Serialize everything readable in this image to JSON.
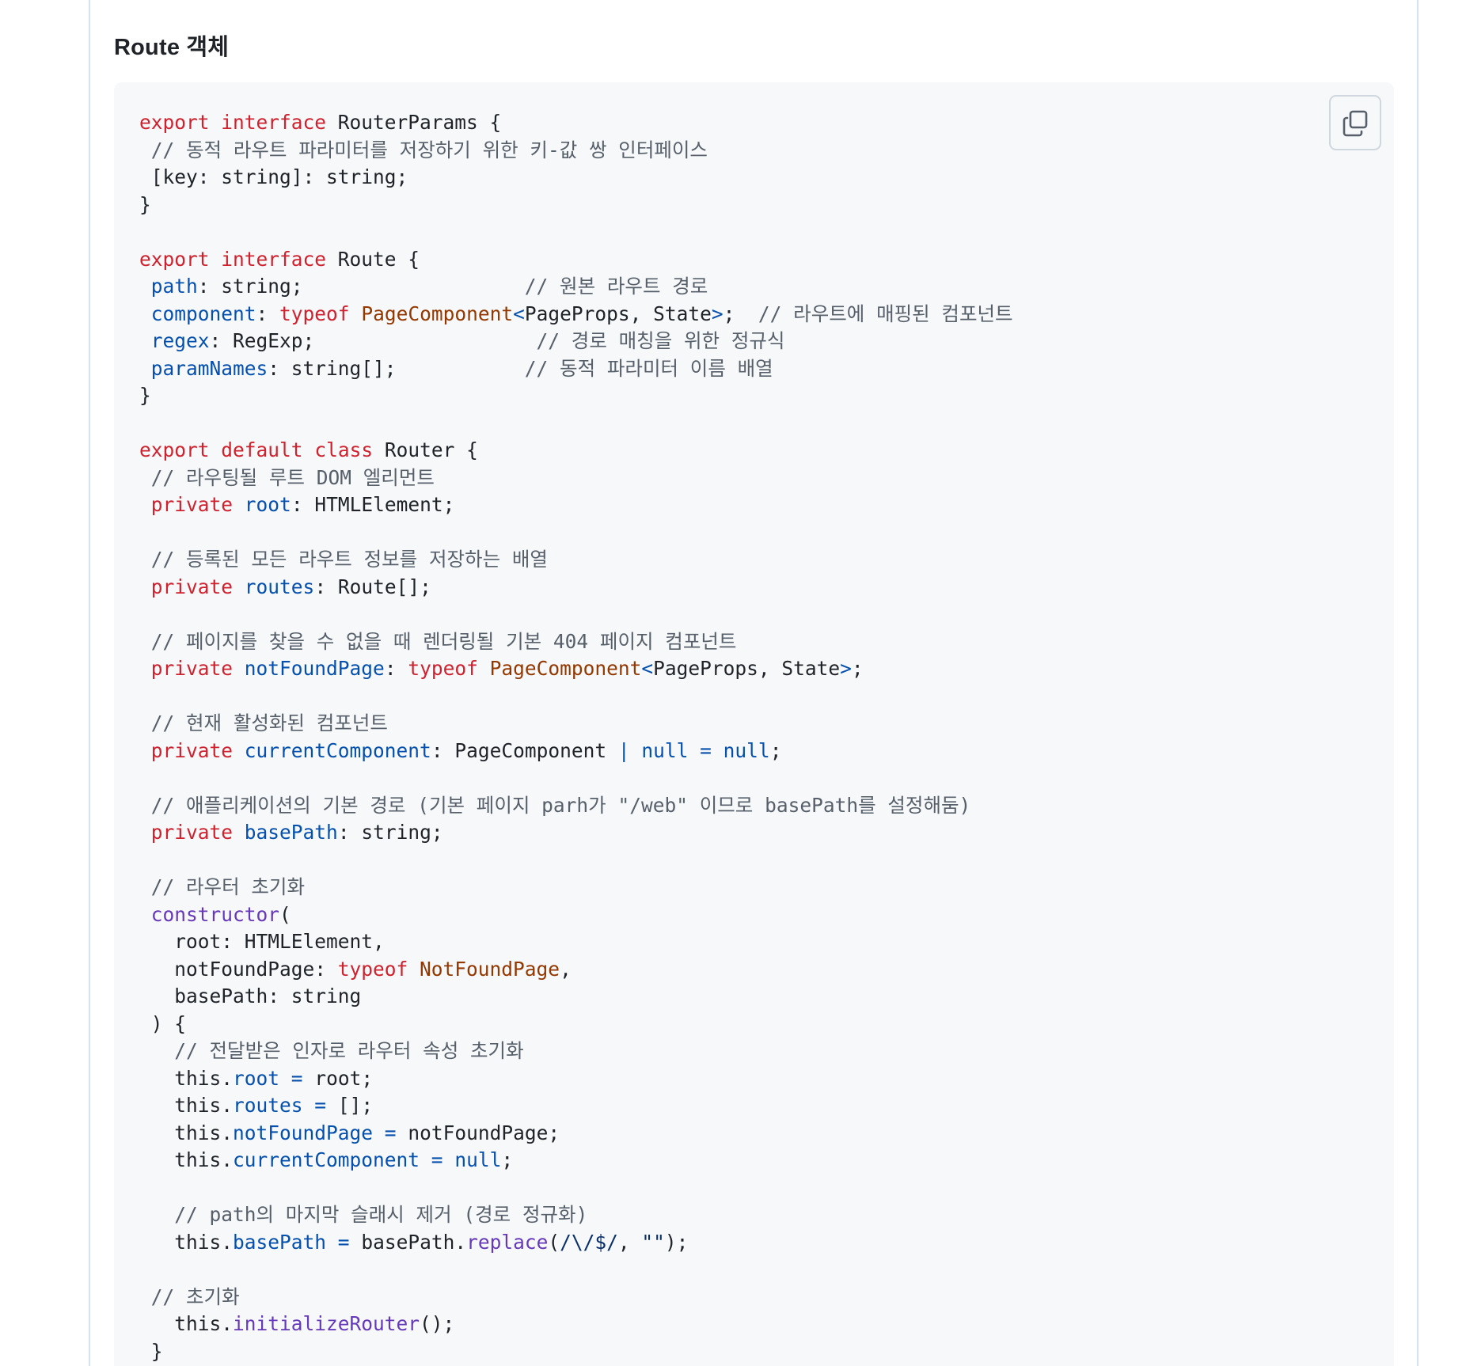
{
  "heading": "Route 객체",
  "copy_button": {
    "icon": "copy-icon"
  },
  "code_lines": [
    [
      [
        "kw",
        "export"
      ],
      [
        "p",
        " "
      ],
      [
        "kw",
        "interface"
      ],
      [
        "p",
        " RouterParams {"
      ]
    ],
    [
      [
        "p",
        " "
      ],
      [
        "cm",
        "// 동적 라우트 파라미터를 저장하기 위한 키-값 쌍 인터페이스"
      ]
    ],
    [
      [
        "p",
        " [key: string]: string;"
      ]
    ],
    [
      [
        "p",
        "}"
      ]
    ],
    [],
    [
      [
        "kw",
        "export"
      ],
      [
        "p",
        " "
      ],
      [
        "kw",
        "interface"
      ],
      [
        "p",
        " Route {"
      ]
    ],
    [
      [
        "p",
        " "
      ],
      [
        "prop",
        "path"
      ],
      [
        "p",
        ": string;                   "
      ],
      [
        "cm",
        "// 원본 라우트 경로"
      ]
    ],
    [
      [
        "p",
        " "
      ],
      [
        "prop",
        "component"
      ],
      [
        "p",
        ": "
      ],
      [
        "kw",
        "typeof"
      ],
      [
        "p",
        " "
      ],
      [
        "typ",
        "PageComponent"
      ],
      [
        "op",
        "<"
      ],
      [
        "p",
        "PageProps, State"
      ],
      [
        "op",
        ">"
      ],
      [
        "p",
        ";  "
      ],
      [
        "cm",
        "// 라우트에 매핑된 컴포넌트"
      ]
    ],
    [
      [
        "p",
        " "
      ],
      [
        "prop",
        "regex"
      ],
      [
        "p",
        ": RegExp;                   "
      ],
      [
        "cm",
        "// 경로 매칭을 위한 정규식"
      ]
    ],
    [
      [
        "p",
        " "
      ],
      [
        "prop",
        "paramNames"
      ],
      [
        "p",
        ": string[];           "
      ],
      [
        "cm",
        "// 동적 파라미터 이름 배열"
      ]
    ],
    [
      [
        "p",
        "}"
      ]
    ],
    [],
    [
      [
        "kw",
        "export"
      ],
      [
        "p",
        " "
      ],
      [
        "kw",
        "default"
      ],
      [
        "p",
        " "
      ],
      [
        "kw",
        "class"
      ],
      [
        "p",
        " Router {"
      ]
    ],
    [
      [
        "p",
        " "
      ],
      [
        "cm",
        "// 라우팅될 루트 DOM 엘리먼트"
      ]
    ],
    [
      [
        "p",
        " "
      ],
      [
        "kw",
        "private"
      ],
      [
        "p",
        " "
      ],
      [
        "prop",
        "root"
      ],
      [
        "p",
        ": HTMLElement;"
      ]
    ],
    [],
    [
      [
        "p",
        " "
      ],
      [
        "cm",
        "// 등록된 모든 라우트 정보를 저장하는 배열"
      ]
    ],
    [
      [
        "p",
        " "
      ],
      [
        "kw",
        "private"
      ],
      [
        "p",
        " "
      ],
      [
        "prop",
        "routes"
      ],
      [
        "p",
        ": Route[];"
      ]
    ],
    [],
    [
      [
        "p",
        " "
      ],
      [
        "cm",
        "// 페이지를 찾을 수 없을 때 렌더링될 기본 404 페이지 컴포넌트"
      ]
    ],
    [
      [
        "p",
        " "
      ],
      [
        "kw",
        "private"
      ],
      [
        "p",
        " "
      ],
      [
        "prop",
        "notFoundPage"
      ],
      [
        "p",
        ": "
      ],
      [
        "kw",
        "typeof"
      ],
      [
        "p",
        " "
      ],
      [
        "typ",
        "PageComponent"
      ],
      [
        "op",
        "<"
      ],
      [
        "p",
        "PageProps, State"
      ],
      [
        "op",
        ">"
      ],
      [
        "p",
        ";"
      ]
    ],
    [],
    [
      [
        "p",
        " "
      ],
      [
        "cm",
        "// 현재 활성화된 컴포넌트"
      ]
    ],
    [
      [
        "p",
        " "
      ],
      [
        "kw",
        "private"
      ],
      [
        "p",
        " "
      ],
      [
        "prop",
        "currentComponent"
      ],
      [
        "p",
        ": PageComponent "
      ],
      [
        "op",
        "|"
      ],
      [
        "p",
        " "
      ],
      [
        "op",
        "null"
      ],
      [
        "p",
        " "
      ],
      [
        "op",
        "="
      ],
      [
        "p",
        " "
      ],
      [
        "op",
        "null"
      ],
      [
        "p",
        ";"
      ]
    ],
    [],
    [
      [
        "p",
        " "
      ],
      [
        "cm",
        "// 애플리케이션의 기본 경로 (기본 페이지 parh가 \"/web\" 이므로 basePath를 설정해둠)"
      ]
    ],
    [
      [
        "p",
        " "
      ],
      [
        "kw",
        "private"
      ],
      [
        "p",
        " "
      ],
      [
        "prop",
        "basePath"
      ],
      [
        "p",
        ": string;"
      ]
    ],
    [],
    [
      [
        "p",
        " "
      ],
      [
        "cm",
        "// 라우터 초기화"
      ]
    ],
    [
      [
        "p",
        " "
      ],
      [
        "fn",
        "constructor"
      ],
      [
        "p",
        "("
      ]
    ],
    [
      [
        "p",
        "   root: HTMLElement,"
      ]
    ],
    [
      [
        "p",
        "   notFoundPage: "
      ],
      [
        "kw",
        "typeof"
      ],
      [
        "p",
        " "
      ],
      [
        "typ",
        "NotFoundPage"
      ],
      [
        "p",
        ","
      ]
    ],
    [
      [
        "p",
        "   basePath: string"
      ]
    ],
    [
      [
        "p",
        " ) {"
      ]
    ],
    [
      [
        "p",
        "   "
      ],
      [
        "cm",
        "// 전달받은 인자로 라우터 속성 초기화"
      ]
    ],
    [
      [
        "p",
        "   this."
      ],
      [
        "prop",
        "root"
      ],
      [
        "p",
        " "
      ],
      [
        "op",
        "="
      ],
      [
        "p",
        " root;"
      ]
    ],
    [
      [
        "p",
        "   this."
      ],
      [
        "prop",
        "routes"
      ],
      [
        "p",
        " "
      ],
      [
        "op",
        "="
      ],
      [
        "p",
        " [];"
      ]
    ],
    [
      [
        "p",
        "   this."
      ],
      [
        "prop",
        "notFoundPage"
      ],
      [
        "p",
        " "
      ],
      [
        "op",
        "="
      ],
      [
        "p",
        " notFoundPage;"
      ]
    ],
    [
      [
        "p",
        "   this."
      ],
      [
        "prop",
        "currentComponent"
      ],
      [
        "p",
        " "
      ],
      [
        "op",
        "="
      ],
      [
        "p",
        " "
      ],
      [
        "op",
        "null"
      ],
      [
        "p",
        ";"
      ]
    ],
    [],
    [
      [
        "p",
        "   "
      ],
      [
        "cm",
        "// path의 마지막 슬래시 제거 (경로 정규화)"
      ]
    ],
    [
      [
        "p",
        "   this."
      ],
      [
        "prop",
        "basePath"
      ],
      [
        "p",
        " "
      ],
      [
        "op",
        "="
      ],
      [
        "p",
        " basePath."
      ],
      [
        "fn",
        "replace"
      ],
      [
        "p",
        "("
      ],
      [
        "rx",
        "/\\/$/"
      ],
      [
        "p",
        ", "
      ],
      [
        "rx",
        "\"\""
      ],
      [
        "p",
        ");"
      ]
    ],
    [],
    [
      [
        "p",
        " "
      ],
      [
        "cm",
        "// 초기화"
      ]
    ],
    [
      [
        "p",
        "   this."
      ],
      [
        "fn",
        "initializeRouter"
      ],
      [
        "p",
        "();"
      ]
    ],
    [
      [
        "p",
        " }"
      ]
    ]
  ]
}
